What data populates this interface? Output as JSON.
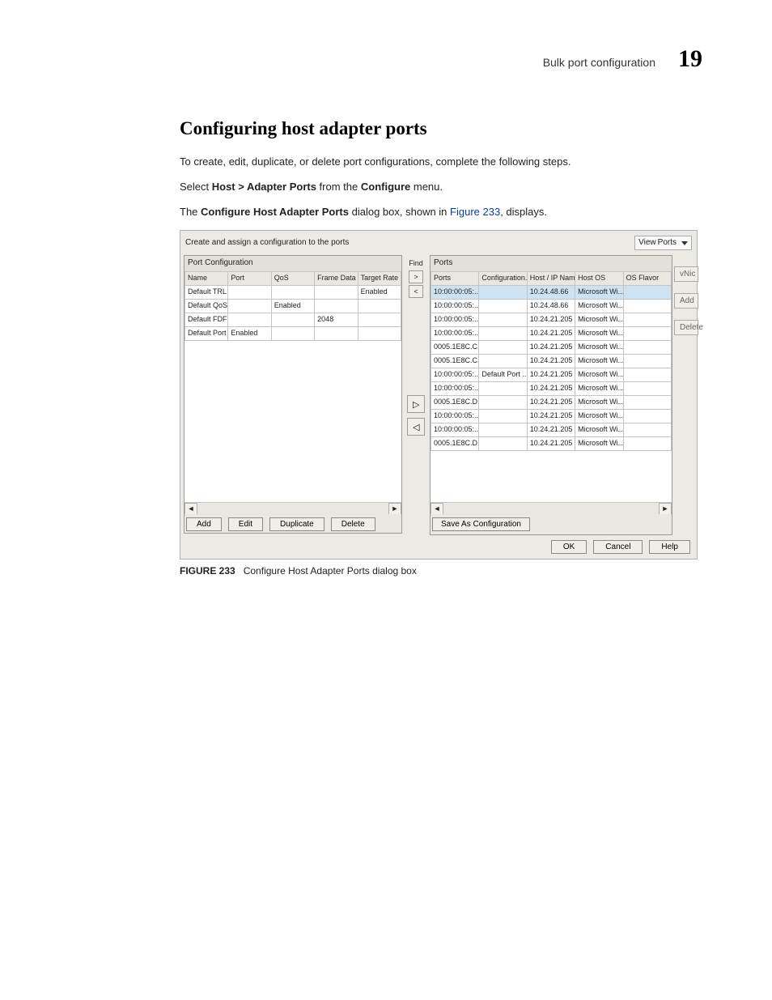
{
  "header": {
    "section_title": "Bulk port configuration",
    "chapter_number": "19"
  },
  "heading": "Configuring host adapter ports",
  "paragraphs": {
    "intro": "To create, edit, duplicate, or delete port configurations, complete the following steps.",
    "step_prefix": "Select ",
    "step_bold1": "Host > Adapter Ports",
    "step_mid": " from the ",
    "step_bold2": "Configure",
    "step_suffix": " menu.",
    "line3_prefix": "The ",
    "line3_bold": "Configure Host Adapter Ports",
    "line3_mid": " dialog box, shown in ",
    "line3_link": "Figure 233",
    "line3_suffix": ", displays."
  },
  "figure_caption": {
    "label": "FIGURE 233",
    "text": "Configure Host Adapter Ports dialog box"
  },
  "dialog": {
    "instruction": "Create and assign a configuration to the ports",
    "view_label": "View",
    "view_value": "Ports",
    "left_panel_title": "Port Configuration",
    "right_panel_title": "Ports",
    "find_label": "Find",
    "left_columns": [
      "Name",
      "Port",
      "QoS",
      "Frame Data ...",
      "Target Rate"
    ],
    "left_rows": [
      {
        "name": "Default TRL ...",
        "port": "",
        "qos": "",
        "frame": "",
        "target": "Enabled"
      },
      {
        "name": "Default QoS ...",
        "port": "",
        "qos": "Enabled",
        "frame": "",
        "target": ""
      },
      {
        "name": "Default FDFS...",
        "port": "",
        "qos": "",
        "frame": "2048",
        "target": ""
      },
      {
        "name": "Default Port ...",
        "port": "Enabled",
        "qos": "",
        "frame": "",
        "target": ""
      }
    ],
    "right_columns": [
      "Ports",
      "Configuration...",
      "Host / IP Name",
      "Host OS",
      "OS Flavor"
    ],
    "right_rows": [
      {
        "ports": "10:00:00:05:...",
        "config": "",
        "host": "10.24.48.66",
        "os": "Microsoft Wi...",
        "flavor": ""
      },
      {
        "ports": "10:00:00:05:...",
        "config": "",
        "host": "10.24.48.66",
        "os": "Microsoft Wi...",
        "flavor": ""
      },
      {
        "ports": "10:00:00:05:...",
        "config": "",
        "host": "10.24.21.205",
        "os": "Microsoft Wi...",
        "flavor": ""
      },
      {
        "ports": "10:00:00:05:...",
        "config": "",
        "host": "10.24.21.205",
        "os": "Microsoft Wi...",
        "flavor": ""
      },
      {
        "ports": "0005.1E8C.C...",
        "config": "",
        "host": "10.24.21.205",
        "os": "Microsoft Wi...",
        "flavor": ""
      },
      {
        "ports": "0005.1E8C.C...",
        "config": "",
        "host": "10.24.21.205",
        "os": "Microsoft Wi...",
        "flavor": ""
      },
      {
        "ports": "10:00:00:05:...",
        "config": "Default Port ...",
        "host": "10.24.21.205",
        "os": "Microsoft Wi...",
        "flavor": ""
      },
      {
        "ports": "10:00:00:05:...",
        "config": "",
        "host": "10.24.21.205",
        "os": "Microsoft Wi...",
        "flavor": ""
      },
      {
        "ports": "0005.1E8C.D...",
        "config": "",
        "host": "10.24.21.205",
        "os": "Microsoft Wi...",
        "flavor": ""
      },
      {
        "ports": "10:00:00:05:...",
        "config": "",
        "host": "10.24.21.205",
        "os": "Microsoft Wi...",
        "flavor": ""
      },
      {
        "ports": "10:00:00:05:...",
        "config": "",
        "host": "10.24.21.205",
        "os": "Microsoft Wi...",
        "flavor": ""
      },
      {
        "ports": "0005.1E8C.D...",
        "config": "",
        "host": "10.24.21.205",
        "os": "Microsoft Wi...",
        "flavor": ""
      }
    ],
    "buttons": {
      "add": "Add",
      "edit": "Edit",
      "duplicate": "Duplicate",
      "delete": "Delete",
      "save_config": "Save As Configuration",
      "vnic": "vNic",
      "side_add": "Add",
      "side_delete": "Delete",
      "ok": "OK",
      "cancel": "Cancel",
      "help": "Help"
    }
  }
}
